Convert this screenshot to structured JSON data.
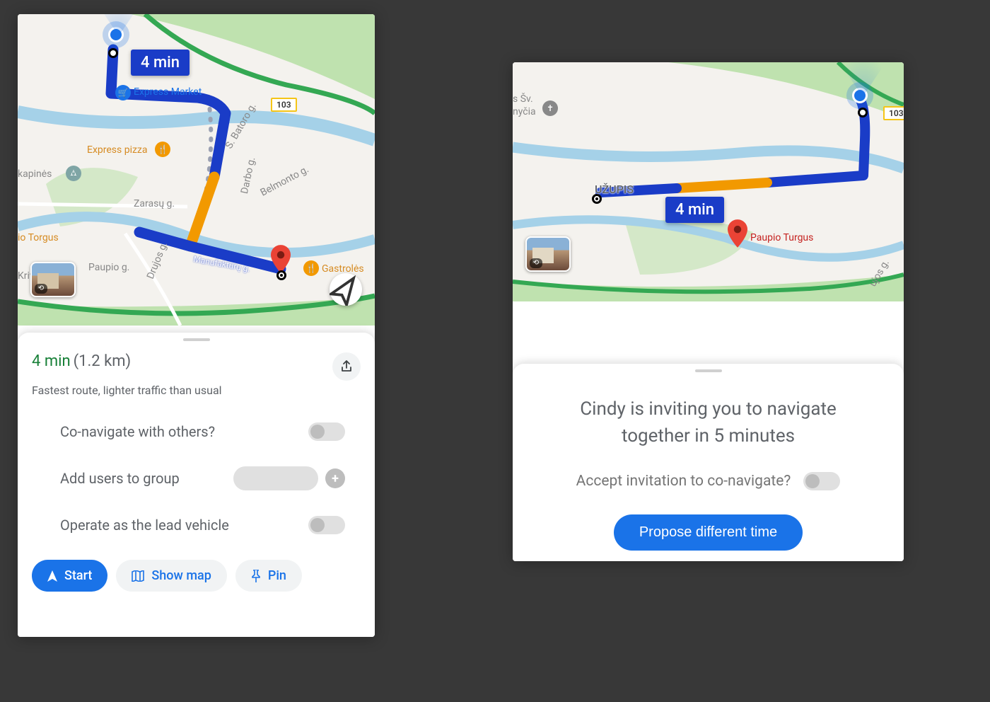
{
  "left": {
    "map": {
      "route_time_badge": "4 min",
      "labels": {
        "express_market": "Express Market",
        "express_pizza": "Express pizza",
        "kapines": "kapinės",
        "io_torgus": "io Torgus",
        "kriv": "Kriv",
        "gastroles": "Gastrolės",
        "zarasu": "Zarasų g.",
        "paupio": "Paupio g.",
        "drujos": "Drujos g.",
        "manufakturu": "Manufaktūrų g.",
        "batoro": "S. Batoro g.",
        "darbo": "Darbo g.",
        "belmonto": "Belmonto g."
      },
      "road_shield": "103"
    },
    "sheet": {
      "duration": "4 min",
      "distance": "(1.2 km)",
      "description": "Fastest route, lighter traffic than usual",
      "options": {
        "co_navigate": "Co-navigate  with others?",
        "add_users": "Add users to group",
        "lead_vehicle": "Operate as the lead vehicle"
      },
      "actions": {
        "start": "Start",
        "show_map": "Show map",
        "pin": "Pin"
      }
    }
  },
  "right": {
    "map": {
      "route_time_badge": "4 min",
      "labels": {
        "sv": "s Šv.",
        "nycia": "nyčia",
        "uzupis": "UŽUPIS",
        "paupio_turgus": "Paupio Turgus",
        "ujos": "ujos g."
      },
      "road_shield": "103"
    },
    "sheet": {
      "invite_text": "Cindy is inviting you to navigate together in 5 minutes",
      "accept_label": "Accept invitation to co-navigate?",
      "propose_label": "Propose different time"
    }
  }
}
